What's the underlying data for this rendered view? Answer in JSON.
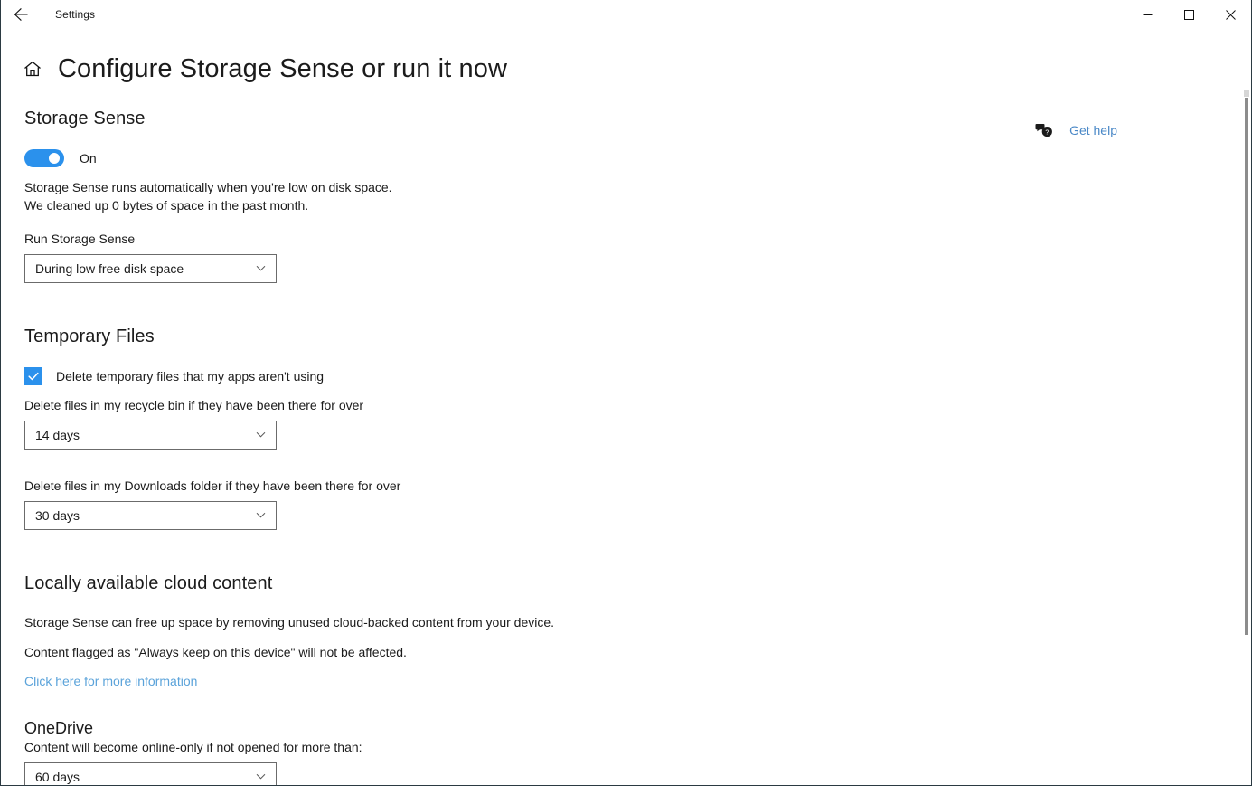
{
  "window": {
    "titlebar_title": "Settings",
    "back_icon": "back-arrow-icon",
    "minimize_label": "Minimize",
    "maximize_label": "Maximize",
    "close_label": "Close"
  },
  "header": {
    "home_icon": "home-icon",
    "page_title": "Configure Storage Sense or run it now"
  },
  "get_help": {
    "icon": "help-chat-icon",
    "label": "Get help"
  },
  "storage_sense": {
    "heading": "Storage Sense",
    "toggle_state": "On",
    "toggle_on": true,
    "description": "Storage Sense runs automatically when you're low on disk space. We cleaned up 0 bytes of space in the past month.",
    "run_label": "Run Storage Sense",
    "run_value": "During low free disk space"
  },
  "temporary_files": {
    "heading": "Temporary Files",
    "checkbox_label": "Delete temporary files that my apps aren't using",
    "checkbox_checked": true,
    "recycle_label": "Delete files in my recycle bin if they have been there for over",
    "recycle_value": "14 days",
    "downloads_label": "Delete files in my Downloads folder if they have been there for over",
    "downloads_value": "30 days"
  },
  "cloud_content": {
    "heading": "Locally available cloud content",
    "paragraph_1": "Storage Sense can free up space by removing unused cloud-backed content from your device.",
    "paragraph_2": "Content flagged as \"Always keep on this device\" will not be affected.",
    "link_text": "Click here for more information",
    "onedrive_heading": "OneDrive",
    "onedrive_label": "Content will become online-only if not opened for more than:",
    "onedrive_value": "60 days"
  },
  "colors": {
    "accent": "#2b91ec",
    "link": "#5ba3da",
    "get_help_link": "#4a88c7",
    "text": "#1b1b1b",
    "border": "#6b6b6b"
  }
}
